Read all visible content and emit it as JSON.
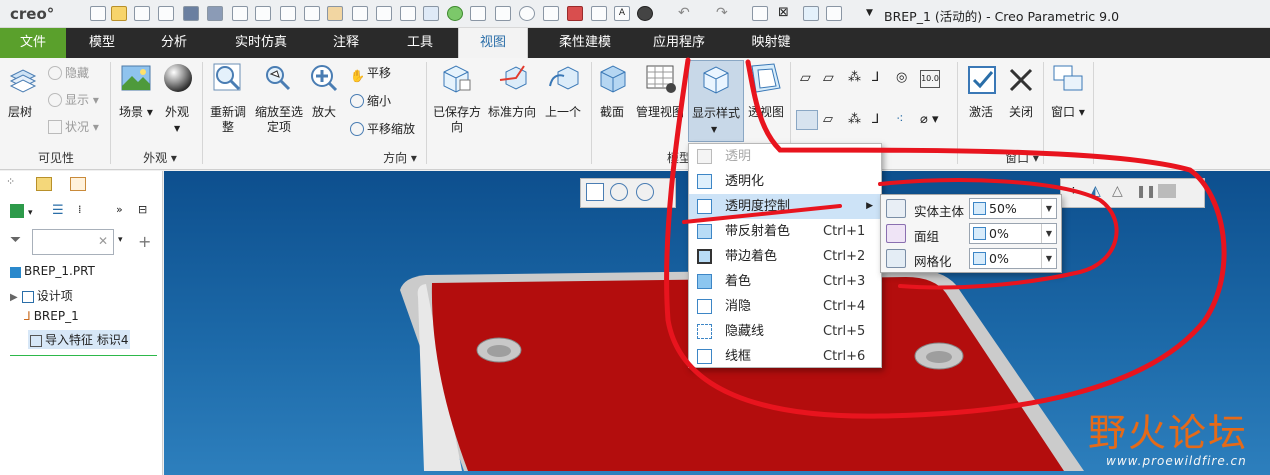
{
  "app": {
    "logo": "creo°",
    "title": "BREP_1 (活动的) - Creo Parametric 9.0"
  },
  "tabs": [
    "文件",
    "模型",
    "分析",
    "实时仿真",
    "注释",
    "工具",
    "视图",
    "柔性建模",
    "应用程序",
    "映射键"
  ],
  "active_tab": "视图",
  "ribbon": {
    "visibility": {
      "tree_label": "层树",
      "hide": "隐藏",
      "show": "显示",
      "status": "状况",
      "group": "可见性"
    },
    "appearance": {
      "scene": "场景",
      "appearance": "外观",
      "group": "外观"
    },
    "orientation": {
      "refit": "重新调整",
      "zoom_to_selected": "缩放至选定项",
      "zoom_in": "放大",
      "pan": "平移",
      "zoom_out": "缩小",
      "pan_zoom": "平移缩放",
      "group": "方向"
    },
    "views": {
      "saved": "已保存方向",
      "standard": "标准方向",
      "previous": "上一个"
    },
    "model_display": {
      "section": "截面",
      "manage_views": "管理视图",
      "display_style": "显示样式",
      "perspective": "透视图",
      "group": "模型显示"
    },
    "window": {
      "activate": "激活",
      "close": "关闭",
      "window": "窗口",
      "group": "窗口"
    }
  },
  "left_panel": {
    "tree": [
      {
        "label": "BREP_1.PRT"
      },
      {
        "label": "设计项"
      },
      {
        "label": "BREP_1"
      },
      {
        "label": "导入特征 标识4"
      }
    ]
  },
  "display_menu": {
    "items": [
      {
        "label": "透明",
        "shortcut": "",
        "state": "disabled"
      },
      {
        "label": "透明化",
        "shortcut": "",
        "state": "normal"
      },
      {
        "label": "透明度控制",
        "shortcut": "",
        "state": "selected"
      },
      {
        "label": "带反射着色",
        "shortcut": "Ctrl+1",
        "state": "normal"
      },
      {
        "label": "带边着色",
        "shortcut": "Ctrl+2",
        "state": "normal"
      },
      {
        "label": "着色",
        "shortcut": "Ctrl+3",
        "state": "normal"
      },
      {
        "label": "消隐",
        "shortcut": "Ctrl+4",
        "state": "normal"
      },
      {
        "label": "隐藏线",
        "shortcut": "Ctrl+5",
        "state": "normal"
      },
      {
        "label": "线框",
        "shortcut": "Ctrl+6",
        "state": "normal"
      }
    ]
  },
  "transparency_panel": {
    "rows": [
      {
        "label": "实体主体",
        "value": "50%"
      },
      {
        "label": "面组",
        "value": "0%"
      },
      {
        "label": "网格化",
        "value": "0%"
      }
    ]
  },
  "watermark": {
    "brand": "野火论坛",
    "url": "www.proewildfire.cn"
  },
  "colors": {
    "file_tab": "#5aa02c",
    "active_tab_text": "#2a6ea8",
    "viewport_top": "#0d4f8e",
    "part_face": "#b30d0d",
    "annotation_red": "#e8141e",
    "watermark": "#f06a10"
  }
}
